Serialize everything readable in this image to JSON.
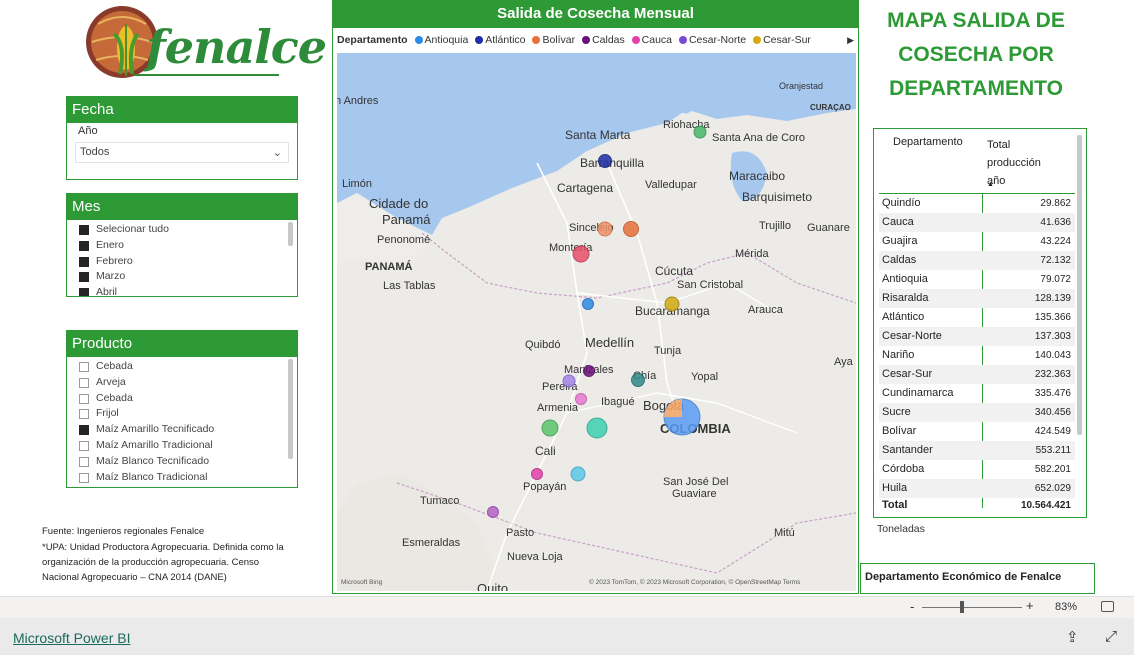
{
  "logo": {
    "text": "fenalce"
  },
  "slicer_fecha": {
    "title": "Fecha",
    "label": "Año",
    "value": "Todos"
  },
  "slicer_mes": {
    "title": "Mes",
    "items": [
      {
        "label": "Selecionar tudo",
        "checked": true
      },
      {
        "label": "Enero",
        "checked": true
      },
      {
        "label": "Febrero",
        "checked": true
      },
      {
        "label": "Marzo",
        "checked": true
      },
      {
        "label": "Abril",
        "checked": true
      }
    ]
  },
  "slicer_producto": {
    "title": "Producto",
    "items": [
      {
        "label": "Cebada",
        "checked": false
      },
      {
        "label": "Arveja",
        "checked": false
      },
      {
        "label": "Cebada",
        "checked": false
      },
      {
        "label": "Frijol",
        "checked": false
      },
      {
        "label": "Maíz Amarillo Tecnificado",
        "checked": true
      },
      {
        "label": "Maíz Amarillo Tradicional",
        "checked": false
      },
      {
        "label": "Maíz Blanco Tecnificado",
        "checked": false
      },
      {
        "label": "Maíz Blanco Tradicional",
        "checked": false
      }
    ]
  },
  "notes": {
    "source": "Fuente: Ingenieros regionales Fenalce",
    "upa_1": "*UPA: Unidad Productora Agropecuaria. Definida como la",
    "upa_2": "organización de la producción agropecuaria. Censo",
    "upa_3": "Nacional Agropecuario – CNA 2014 (DANE)"
  },
  "map": {
    "title": "Salida de Cosecha Mensual",
    "legend_title": "Departamento",
    "legend": [
      {
        "label": "Antioquia",
        "color": "#2b8be6"
      },
      {
        "label": "Atlántico",
        "color": "#1d2ea8"
      },
      {
        "label": "Bolívar",
        "color": "#e8703a"
      },
      {
        "label": "Caldas",
        "color": "#6b0f7a"
      },
      {
        "label": "Cauca",
        "color": "#e23fa8"
      },
      {
        "label": "Cesar-Norte",
        "color": "#7a4ad6"
      },
      {
        "label": "Cesar-Sur",
        "color": "#d3aa0f"
      }
    ],
    "places": {
      "orangestad": "Oranjestad",
      "curacao": "CURAÇAO",
      "san_andres": "n Andres",
      "riohacha": "Riohacha",
      "santa_marta": "Santa Marta",
      "santa_ana": "Santa Ana de Coro",
      "barranquilla": "Barranquilla",
      "valledupar": "Valledupar",
      "maracaibo": "Maracaibo",
      "cartagena": "Cartagena",
      "barquisimeto": "Barquisimeto",
      "limon": "Limón",
      "cidade": "Cidade do",
      "panama_city": "Panamá",
      "sincelejo": "Sincelejo",
      "trujillo": "Trujillo",
      "guanare": "Guanare",
      "penonome": "Penonomé",
      "monteria": "Montería",
      "merida": "Mérida",
      "panama": "PANAMÁ",
      "cucuta": "Cúcuta",
      "las_tablas": "Las Tablas",
      "san_cristobal": "San Cristobal",
      "bucaramanga": "Bucaramanga",
      "arauca": "Arauca",
      "quibdo": "Quibdó",
      "medellin": "Medellín",
      "tunja": "Tunja",
      "ayac": "Aya",
      "manizales": "Manizales",
      "yopal": "Yopal",
      "pereira": "Pereira",
      "chia": "Chía",
      "ibague": "Ibagué",
      "armenia": "Armenia",
      "bogota": "Bogotá",
      "colombia": "COLOMBIA",
      "cali": "Cali",
      "popayan": "Popayán",
      "san_jose": "San José Del",
      "guaviare": "Guaviare",
      "tumaco": "Tumaco",
      "pasto": "Pasto",
      "mitu": "Mitú",
      "esmeraldas": "Esmeraldas",
      "nueva_loja": "Nueva Loja",
      "quito": "Quito"
    },
    "bing": "Microsoft Bing",
    "copyright": "© 2023 TomTom, © 2023 Microsoft Corporation, © OpenStreetMap  Terms"
  },
  "page_title": {
    "line1": "MAPA SALIDA DE",
    "line2": "COSECHA POR",
    "line3": "DEPARTAMENTO"
  },
  "table": {
    "col1": "Departamento",
    "col2_l1": "Total",
    "col2_l2": "producción",
    "col2_l3": "año",
    "sort_icon": "▲",
    "rows": [
      {
        "dept": "Quindío",
        "value": "29.862"
      },
      {
        "dept": "Cauca",
        "value": "41.636"
      },
      {
        "dept": "Guajira",
        "value": "43.224"
      },
      {
        "dept": "Caldas",
        "value": "72.132"
      },
      {
        "dept": "Antioquia",
        "value": "79.072"
      },
      {
        "dept": "Risaralda",
        "value": "128.139"
      },
      {
        "dept": "Atlántico",
        "value": "135.366"
      },
      {
        "dept": "Cesar-Norte",
        "value": "137.303"
      },
      {
        "dept": "Nariño",
        "value": "140.043"
      },
      {
        "dept": "Cesar-Sur",
        "value": "232.363"
      },
      {
        "dept": "Cundinamarca",
        "value": "335.476"
      },
      {
        "dept": "Sucre",
        "value": "340.456"
      },
      {
        "dept": "Bolívar",
        "value": "424.549"
      },
      {
        "dept": "Santander",
        "value": "553.211"
      },
      {
        "dept": "Córdoba",
        "value": "582.201"
      },
      {
        "dept": "Huila",
        "value": "652.029"
      }
    ],
    "total_label": "Total",
    "total_value": "10.564.421"
  },
  "units": "Toneladas",
  "dept_econ": "Departamento Económico de Fenalce",
  "zoom": {
    "minus": "-",
    "plus": "+",
    "percent": "83%"
  },
  "footer": {
    "link": "Microsoft Power BI",
    "share_icon": "⇪",
    "expand_icon": "⤢"
  }
}
